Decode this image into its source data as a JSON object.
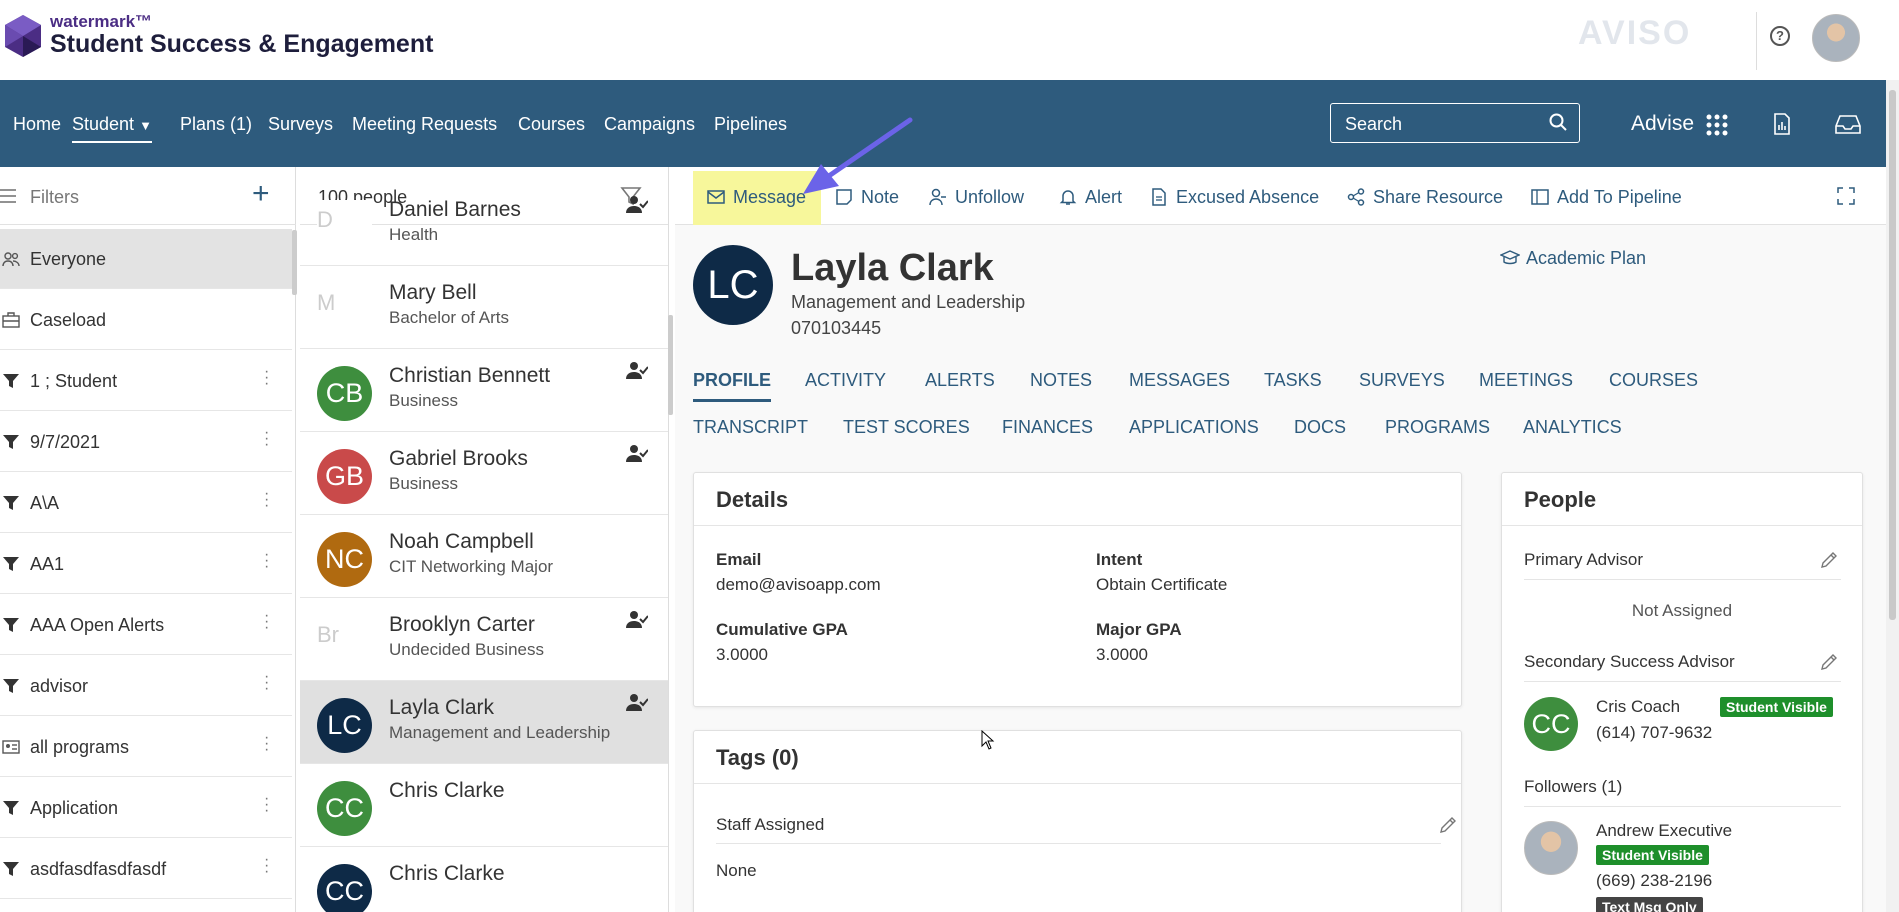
{
  "header": {
    "brand_small": "watermark™",
    "brand_title": "Student Success & Engagement",
    "watermark_text": "AVISO",
    "help_label": "?"
  },
  "nav": {
    "items": [
      "Home",
      "Student",
      "Plans (1)",
      "Surveys",
      "Meeting Requests",
      "Courses",
      "Campaigns",
      "Pipelines"
    ],
    "active_index": 1,
    "search_placeholder": "Search",
    "advise_label": "Advise"
  },
  "filters": {
    "header_label": "Filters",
    "items": [
      {
        "label": "Everyone",
        "icon": "people-icon",
        "selected": true
      },
      {
        "label": "Caseload",
        "icon": "briefcase-icon"
      },
      {
        "label": "1 ; Student",
        "icon": "funnel-icon"
      },
      {
        "label": "9/7/2021",
        "icon": "funnel-icon"
      },
      {
        "label": "A\\A",
        "icon": "funnel-icon"
      },
      {
        "label": "AA1",
        "icon": "funnel-icon"
      },
      {
        "label": "AAA Open Alerts",
        "icon": "funnel-icon"
      },
      {
        "label": "advisor",
        "icon": "funnel-icon"
      },
      {
        "label": "all programs",
        "icon": "id-card-icon"
      },
      {
        "label": "Application",
        "icon": "funnel-icon"
      },
      {
        "label": "asdfasdfasdfasdf",
        "icon": "funnel-icon"
      }
    ]
  },
  "people": {
    "count_label": "100 people",
    "rows": [
      {
        "name": "Daniel Barnes",
        "program": "Health",
        "initials": "D",
        "broken_image": true,
        "followed": true
      },
      {
        "name": "Mary Bell",
        "program": "Bachelor of Arts",
        "initials": "M",
        "broken_image": true,
        "followed": false
      },
      {
        "name": "Christian Bennett",
        "program": "Business",
        "initials": "CB",
        "color": "#3e8e3e",
        "followed": true
      },
      {
        "name": "Gabriel Brooks",
        "program": "Business",
        "initials": "GB",
        "color": "#c94a4a",
        "followed": true
      },
      {
        "name": "Noah Campbell",
        "program": "CIT Networking Major",
        "initials": "NC",
        "color": "#b06a10",
        "followed": false
      },
      {
        "name": "Brooklyn Carter",
        "program": "Undecided Business",
        "initials": "Br",
        "broken_image": true,
        "followed": true
      },
      {
        "name": "Layla Clark",
        "program": "Management and Leadership",
        "initials": "LC",
        "color": "#0e2a47",
        "followed": true,
        "selected": true
      },
      {
        "name": "Chris Clarke",
        "program": "",
        "initials": "CC",
        "color": "#3e8e3e",
        "followed": false
      },
      {
        "name": "Chris Clarke",
        "program": "",
        "initials": "CC",
        "color": "#0e2a47",
        "followed": false
      }
    ]
  },
  "actions": {
    "items": [
      "Message",
      "Note",
      "Unfollow",
      "Alert",
      "Excused Absence",
      "Share Resource",
      "Add To Pipeline"
    ]
  },
  "student": {
    "initials": "LC",
    "name": "Layla Clark",
    "program": "Management and Leadership",
    "id": "070103445",
    "academic_plan_label": "Academic Plan"
  },
  "tabs": {
    "row1": [
      "PROFILE",
      "ACTIVITY",
      "ALERTS",
      "NOTES",
      "MESSAGES",
      "TASKS",
      "SURVEYS",
      "MEETINGS",
      "COURSES"
    ],
    "row2": [
      "TRANSCRIPT",
      "TEST SCORES",
      "FINANCES",
      "APPLICATIONS",
      "DOCS",
      "PROGRAMS",
      "ANALYTICS"
    ],
    "active": "PROFILE"
  },
  "details": {
    "title": "Details",
    "email_label": "Email",
    "email_value": "demo@avisoapp.com",
    "intent_label": "Intent",
    "intent_value": "Obtain Certificate",
    "cum_gpa_label": "Cumulative GPA",
    "cum_gpa_value": "3.0000",
    "major_gpa_label": "Major GPA",
    "major_gpa_value": "3.0000"
  },
  "tags": {
    "title": "Tags (0)",
    "staff_label": "Staff Assigned",
    "staff_value": "None"
  },
  "people_card": {
    "title": "People",
    "primary_label": "Primary Advisor",
    "primary_value": "Not Assigned",
    "secondary_label": "Secondary Success Advisor",
    "secondary_name": "Cris Coach",
    "secondary_initials": "CC",
    "secondary_phone": "(614) 707-9632",
    "visible_badge": "Student Visible",
    "followers_label": "Followers (1)",
    "follower_name": "Andrew Executive",
    "follower_phone": "(669) 238-2196",
    "text_only_badge": "Text Msg Only"
  },
  "colors": {
    "nav_bg": "#2e5b7d",
    "accent": "#2e5b7d",
    "highlight": "#f7f79b",
    "badge_green": "#1e8f2b",
    "arrow": "#6b63e8"
  }
}
